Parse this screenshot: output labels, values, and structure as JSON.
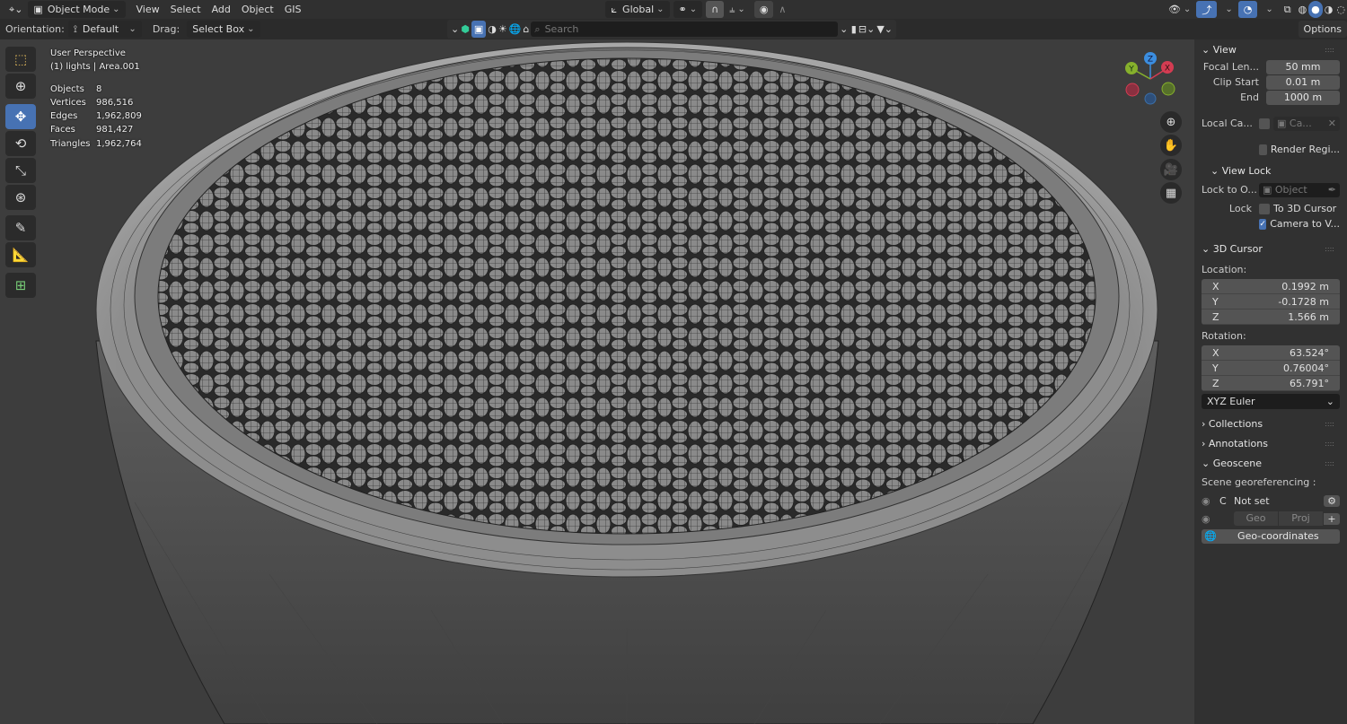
{
  "header": {
    "editor_icon": "editor-type-icon",
    "mode": "Object Mode",
    "menus": [
      "View",
      "Select",
      "Add",
      "Object",
      "GIS"
    ],
    "orientation": "Global",
    "options_label": "Options"
  },
  "tool_header": {
    "orientation_label": "Orientation:",
    "orientation_value": "Default",
    "drag_label": "Drag:",
    "drag_value": "Select Box",
    "search_placeholder": "Search"
  },
  "overlay": {
    "view_name": "User Perspective",
    "collection": "(1) lights | Area.001",
    "stats": [
      {
        "label": "Objects",
        "value": "8"
      },
      {
        "label": "Vertices",
        "value": "986,516"
      },
      {
        "label": "Edges",
        "value": "1,962,809"
      },
      {
        "label": "Faces",
        "value": "981,427"
      },
      {
        "label": "Triangles",
        "value": "1,962,764"
      }
    ]
  },
  "gizmo": {
    "x": "X",
    "y": "Y",
    "z": "Z"
  },
  "panel": {
    "view": {
      "title": "View",
      "focal_label": "Focal Len...",
      "focal": "50 mm",
      "clip_start_label": "Clip Start",
      "clip_start": "0.01 m",
      "end_label": "End",
      "end": "1000 m",
      "local_cam_label": "Local Ca...",
      "local_cam": "Ca...",
      "render_region": "Render Regi..."
    },
    "view_lock": {
      "title": "View Lock",
      "lock_obj_label": "Lock to O...",
      "lock_obj": "Object",
      "lock_label": "Lock",
      "to_cursor": "To 3D Cursor",
      "camera_to_view": "Camera to V..."
    },
    "cursor": {
      "title": "3D Cursor",
      "location_label": "Location:",
      "location": [
        {
          "axis": "X",
          "value": "0.1992 m"
        },
        {
          "axis": "Y",
          "value": "-0.1728 m"
        },
        {
          "axis": "Z",
          "value": "1.566 m"
        }
      ],
      "rotation_label": "Rotation:",
      "rotation": [
        {
          "axis": "X",
          "value": "63.524°"
        },
        {
          "axis": "Y",
          "value": "0.76004°"
        },
        {
          "axis": "Z",
          "value": "65.791°"
        }
      ],
      "rotation_mode": "XYZ Euler"
    },
    "collections": "Collections",
    "annotations": "Annotations",
    "geoscene": {
      "title": "Geoscene",
      "georef_label": "Scene georeferencing :",
      "c": "C",
      "status": "Not set",
      "geo": "Geo",
      "proj": "Proj",
      "plus": "+",
      "geo_coords": "Geo-coordinates"
    }
  }
}
